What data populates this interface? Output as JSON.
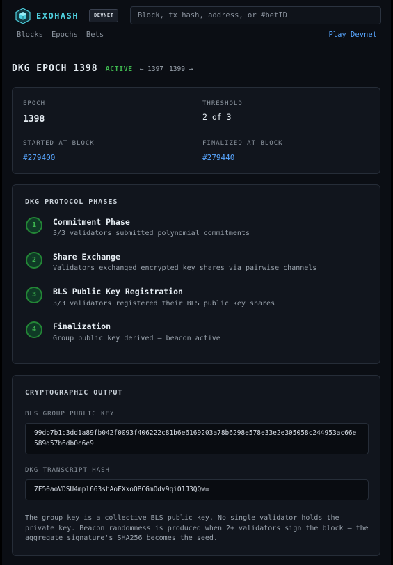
{
  "header": {
    "brand": "EXOHASH",
    "network_badge": "DEVNET",
    "search_placeholder": "Block, tx hash, address, or #betID",
    "nav": [
      "Blocks",
      "Epochs",
      "Bets"
    ],
    "play_link": "Play Devnet",
    "logo_icon": "cube-logo-icon"
  },
  "page": {
    "title": "DKG EPOCH 1398",
    "status": "ACTIVE",
    "prev_epoch": "← 1397",
    "next_epoch": "1399 →"
  },
  "summary": {
    "epoch_label": "EPOCH",
    "epoch_value": "1398",
    "threshold_label": "THRESHOLD",
    "threshold_value": "2 of 3",
    "started_label": "STARTED AT BLOCK",
    "started_value": "#279400",
    "finalized_label": "FINALIZED AT BLOCK",
    "finalized_value": "#279440"
  },
  "phases": {
    "title": "DKG PROTOCOL PHASES",
    "items": [
      {
        "num": "1",
        "title": "Commitment Phase",
        "desc": "3/3 validators submitted polynomial commitments"
      },
      {
        "num": "2",
        "title": "Share Exchange",
        "desc": "Validators exchanged encrypted key shares via pairwise channels"
      },
      {
        "num": "3",
        "title": "BLS Public Key Registration",
        "desc": "3/3 validators registered their BLS public key shares"
      },
      {
        "num": "4",
        "title": "Finalization",
        "desc": "Group public key derived — beacon active"
      }
    ]
  },
  "crypto": {
    "title": "CRYPTOGRAPHIC OUTPUT",
    "group_key_label": "BLS GROUP PUBLIC KEY",
    "group_key_value": "99db7b1c3dd1a89fb042f0093f406222c81b6e6169203a78b6298e578e33e2e305058c244953ac66e589d57b6db0c6e9",
    "transcript_label": "DKG TRANSCRIPT HASH",
    "transcript_value": "7F50aoVDSU4mpl663shAoFXxoOBCGmOdv9qiO1J3QQw=",
    "note": "The group key is a collective BLS public key. No single validator holds the private key. Beacon randomness is produced when 2+ validators sign the block — the aggregate signature's SHA256 becomes the seed."
  },
  "colors": {
    "accent": "#4fd1e0",
    "link": "#58a6ff",
    "active": "#3fb950",
    "background": "#0b0e14",
    "card": "#11151d"
  }
}
